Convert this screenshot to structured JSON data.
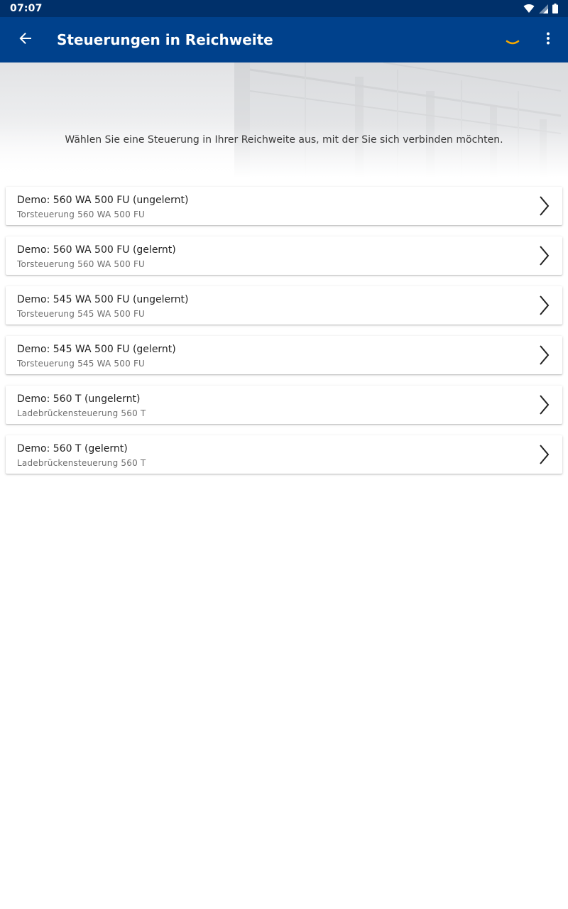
{
  "status_bar": {
    "time": "07:07"
  },
  "app_bar": {
    "title": "Steuerungen in Reichweite"
  },
  "hero": {
    "text": "Wählen Sie eine Steuerung in Ihrer Reichweite aus, mit der Sie sich verbinden möchten."
  },
  "controls": [
    {
      "title": "Demo: 560 WA 500 FU (ungelernt)",
      "subtitle": "Torsteuerung 560 WA 500 FU"
    },
    {
      "title": "Demo: 560 WA 500 FU (gelernt)",
      "subtitle": "Torsteuerung 560 WA 500 FU"
    },
    {
      "title": "Demo: 545 WA 500 FU (ungelernt)",
      "subtitle": "Torsteuerung 545 WA 500 FU"
    },
    {
      "title": "Demo: 545 WA 500 FU (gelernt)",
      "subtitle": "Torsteuerung 545 WA 500 FU"
    },
    {
      "title": "Demo: 560 T (ungelernt)",
      "subtitle": "Ladebrückensteuerung 560 T"
    },
    {
      "title": "Demo: 560 T (gelernt)",
      "subtitle": "Ladebrückensteuerung 560 T"
    }
  ],
  "colors": {
    "app_bar": "#00418c",
    "status_bar": "#00306a",
    "spinner": "#f5a800"
  }
}
